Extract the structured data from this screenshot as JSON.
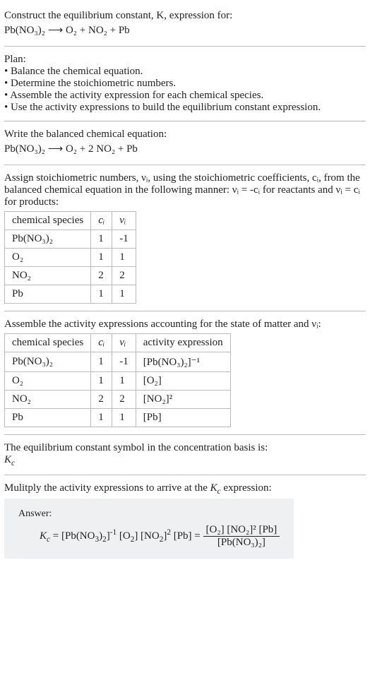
{
  "intro": {
    "line1": "Construct the equilibrium constant, K, expression for:",
    "eq": "Pb(NO₃)₂ ⟶ O₂ + NO₂ + Pb"
  },
  "plan": {
    "title": "Plan:",
    "b1": "• Balance the chemical equation.",
    "b2": "• Determine the stoichiometric numbers.",
    "b3": "• Assemble the activity expression for each chemical species.",
    "b4": "• Use the activity expressions to build the equilibrium constant expression."
  },
  "balanced": {
    "title": "Write the balanced chemical equation:",
    "eq": "Pb(NO₃)₂ ⟶ O₂ + 2 NO₂ + Pb"
  },
  "stoich": {
    "desc": "Assign stoichiometric numbers, νᵢ, using the stoichiometric coefficients, cᵢ, from the balanced chemical equation in the following manner: νᵢ = -cᵢ for reactants and νᵢ = cᵢ for products:",
    "headers": {
      "h1": "chemical species",
      "h2": "cᵢ",
      "h3": "νᵢ"
    },
    "rows": [
      {
        "sp": "Pb(NO₃)₂",
        "c": "1",
        "v": "-1"
      },
      {
        "sp": "O₂",
        "c": "1",
        "v": "1"
      },
      {
        "sp": "NO₂",
        "c": "2",
        "v": "2"
      },
      {
        "sp": "Pb",
        "c": "1",
        "v": "1"
      }
    ]
  },
  "activity": {
    "desc": "Assemble the activity expressions accounting for the state of matter and νᵢ:",
    "headers": {
      "h1": "chemical species",
      "h2": "cᵢ",
      "h3": "νᵢ",
      "h4": "activity expression"
    },
    "rows": [
      {
        "sp": "Pb(NO₃)₂",
        "c": "1",
        "v": "-1",
        "ae": "[Pb(NO₃)₂]⁻¹"
      },
      {
        "sp": "O₂",
        "c": "1",
        "v": "1",
        "ae": "[O₂]"
      },
      {
        "sp": "NO₂",
        "c": "2",
        "v": "2",
        "ae": "[NO₂]²"
      },
      {
        "sp": "Pb",
        "c": "1",
        "v": "1",
        "ae": "[Pb]"
      }
    ]
  },
  "symbol": {
    "line1": "The equilibrium constant symbol in the concentration basis is:",
    "line2": "K_c"
  },
  "multiply": {
    "title": "Mulitply the activity expressions to arrive at the K_c expression:"
  },
  "answer": {
    "label": "Answer:",
    "lhs": "K_c = [Pb(NO₃)₂]⁻¹ [O₂] [NO₂]² [Pb] = ",
    "num": "[O₂] [NO₂]² [Pb]",
    "den": "[Pb(NO₃)₂]"
  },
  "chart_data": {
    "type": "table",
    "tables": [
      {
        "title": "Stoichiometric numbers",
        "headers": [
          "chemical species",
          "cᵢ",
          "νᵢ"
        ],
        "rows": [
          [
            "Pb(NO₃)₂",
            1,
            -1
          ],
          [
            "O₂",
            1,
            1
          ],
          [
            "NO₂",
            2,
            2
          ],
          [
            "Pb",
            1,
            1
          ]
        ]
      },
      {
        "title": "Activity expressions",
        "headers": [
          "chemical species",
          "cᵢ",
          "νᵢ",
          "activity expression"
        ],
        "rows": [
          [
            "Pb(NO₃)₂",
            1,
            -1,
            "[Pb(NO₃)₂]⁻¹"
          ],
          [
            "O₂",
            1,
            1,
            "[O₂]"
          ],
          [
            "NO₂",
            2,
            2,
            "[NO₂]²"
          ],
          [
            "Pb",
            1,
            1,
            "[Pb]"
          ]
        ]
      }
    ]
  }
}
